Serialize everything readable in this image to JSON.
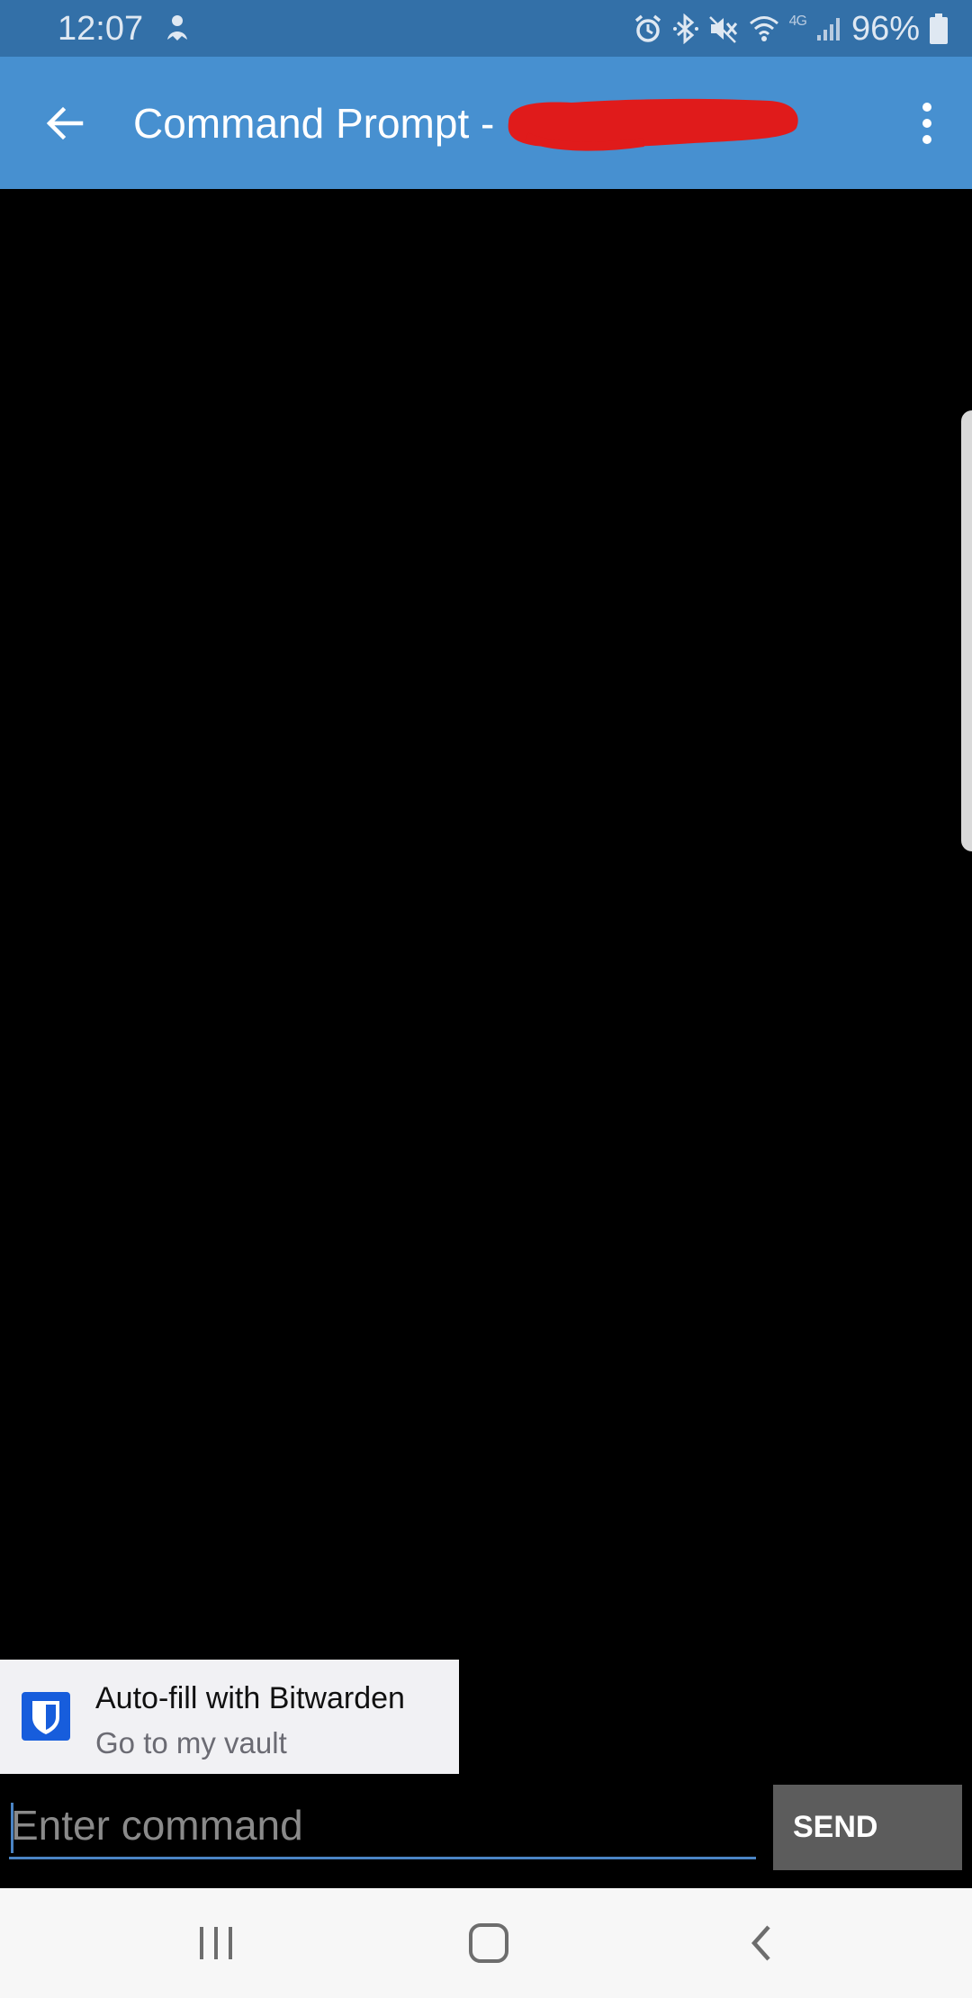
{
  "status_bar": {
    "time": "12:07",
    "battery": "96%",
    "network": "4G",
    "left_icon": "ghost-notification-icon",
    "right_icons": [
      "alarm-icon",
      "bluetooth-icon",
      "mute-icon",
      "wifi-icon",
      "signal-icon",
      "battery-icon"
    ]
  },
  "app_bar": {
    "title": "Command Prompt -",
    "back_icon": "arrow-left-icon",
    "menu_icon": "more-vertical-icon",
    "redaction_color": "#e01b1b",
    "background_color": "#4790d0"
  },
  "autofill": {
    "title": "Auto-fill with Bitwarden",
    "subtitle": "Go to my vault",
    "icon": "bitwarden-shield-icon",
    "icon_color": "#175ddc"
  },
  "input": {
    "placeholder": "Enter command",
    "value": "",
    "accent_color": "#4a84c4"
  },
  "send": {
    "label": "SEND"
  },
  "nav_bar": {
    "icons": [
      "recents-icon",
      "home-icon",
      "back-icon"
    ]
  }
}
